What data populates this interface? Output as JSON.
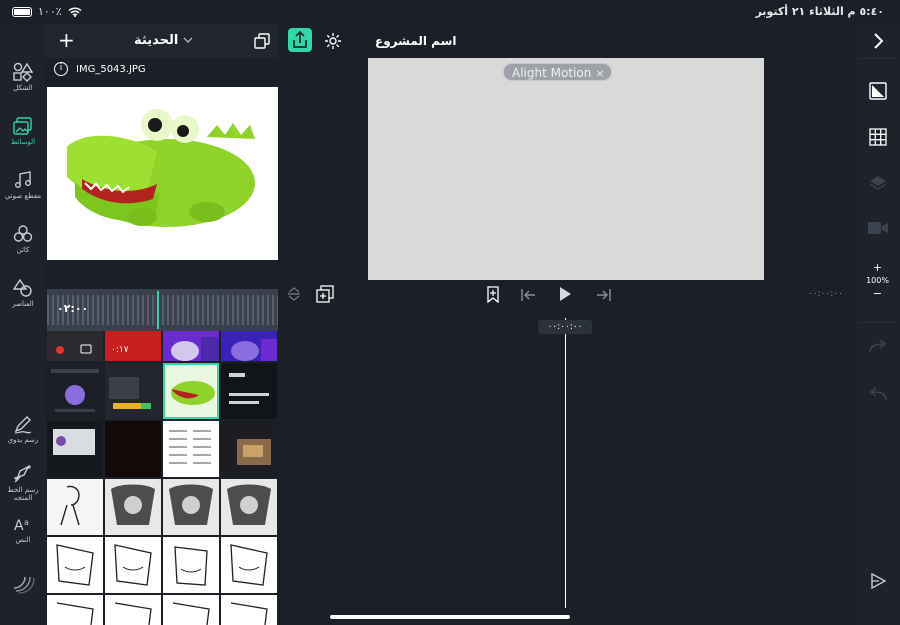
{
  "status_bar": {
    "time_date": "٥:٤٠ م   الثلاثاء ٢١ أكتوبر",
    "battery": "١٠٠٪"
  },
  "left_toolbar": {
    "items": [
      {
        "label": "الشكل",
        "icon": "shape-icon"
      },
      {
        "label": "الوسائط",
        "icon": "media-icon",
        "active": true
      },
      {
        "label": "مقطع صوتي",
        "icon": "music-note-icon"
      },
      {
        "label": "كائن",
        "icon": "group-object-icon"
      },
      {
        "label": "العناصر",
        "icon": "elements-icon"
      },
      {
        "label": "رسم يدوي",
        "icon": "freehand-draw-icon"
      },
      {
        "label": "رسم الخط المتجه",
        "icon": "vector-pen-icon"
      },
      {
        "label": "النص",
        "icon": "text-icon"
      }
    ]
  },
  "media_panel": {
    "header_title": "الحديثة",
    "selected_file": "IMG_5043.JPG",
    "audio_time": "٠٢:٠٠",
    "thumb_label": "٠:١٧"
  },
  "top_bar": {
    "project_name": "اسم المشروع"
  },
  "canvas": {
    "watermark": "Alight Motion",
    "watermark_close": "×"
  },
  "timeline": {
    "current_time": "٠٠:٠٠:٠٠",
    "right_time": "٠٠:٠٠:٠٠"
  },
  "right_toolbar": {
    "zoom_level": "100%",
    "zoom_in": "+",
    "zoom_out": "−"
  },
  "colors": {
    "accent": "#31d7a6",
    "background": "#1b1f27",
    "canvas": "#d9d9d9"
  }
}
